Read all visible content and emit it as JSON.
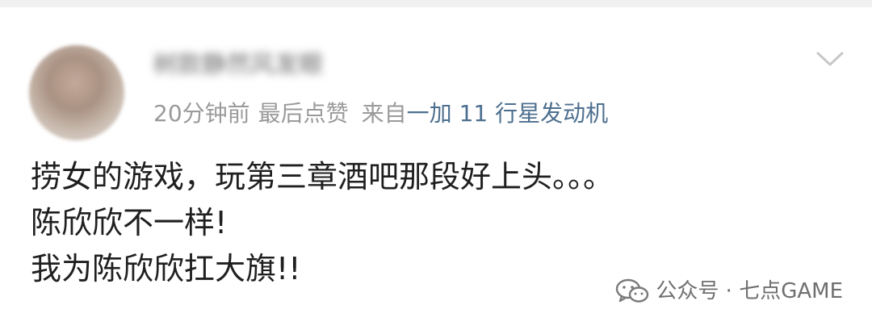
{
  "comment": {
    "username": "树款静然风发眼",
    "time": "20分钟前",
    "likes_label": "最后点赞",
    "from_label": "来自",
    "device": "一加 11 行星发动机",
    "body_lines": [
      "捞女的游戏，玩第三章酒吧那段好上头。。。",
      "陈欣欣不一样!",
      "我为陈欣欣扛大旗!!"
    ]
  },
  "icons": {
    "avatar": "user-avatar",
    "menu": "chevron-down-icon",
    "watermark": "wechat-icon"
  },
  "watermark": {
    "text": "公众号 · 七点GAME"
  },
  "colors": {
    "meta_gray": "#9a9a9a",
    "device_blue": "#4d6f8f",
    "body_text": "#1f1f1f",
    "chevron": "#c8c8c8"
  }
}
